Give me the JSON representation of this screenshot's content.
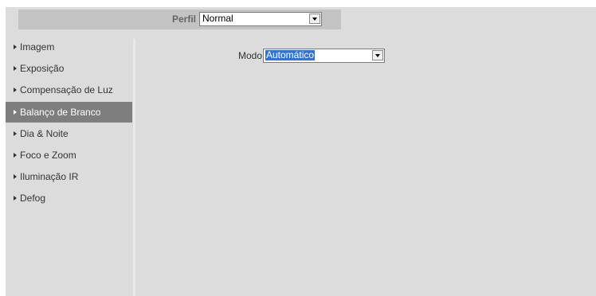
{
  "profile": {
    "label": "Perfil",
    "selected": "Normal"
  },
  "sidebar": {
    "items": [
      {
        "label": "Imagem",
        "active": false
      },
      {
        "label": "Exposição",
        "active": false
      },
      {
        "label": "Compensação de Luz",
        "active": false
      },
      {
        "label": "Balanço de Branco",
        "active": true
      },
      {
        "label": "Dia & Noite",
        "active": false
      },
      {
        "label": "Foco e Zoom",
        "active": false
      },
      {
        "label": "Iluminação IR",
        "active": false
      },
      {
        "label": "Defog",
        "active": false
      }
    ]
  },
  "white_balance": {
    "mode_label": "Modo",
    "mode_selected": "Automático"
  },
  "colors": {
    "active_item_bg": "#7e7e7e",
    "select_highlight": "#3074d9",
    "panel_bg": "#dcdcdc",
    "header_bg": "#c3c3c3"
  },
  "icons": {
    "sidebar_item": "triangle-right-icon",
    "dropdown": "chevron-down-icon"
  }
}
